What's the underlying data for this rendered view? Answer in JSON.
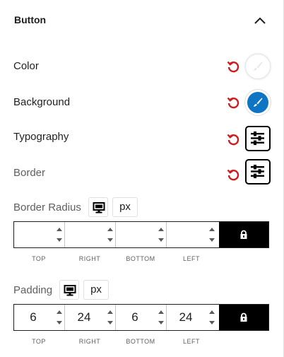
{
  "panel": {
    "title": "Button",
    "collapse_icon": "chevron-up-icon"
  },
  "colors": {
    "reset_red": "#d01c1f",
    "swatch_white": "#ffffff",
    "swatch_blue": "#0e74c4",
    "lock_bg": "#000000"
  },
  "settings": {
    "color_label": "Color",
    "background_label": "Background",
    "typography_label": "Typography",
    "border_label": "Border"
  },
  "border_radius": {
    "label": "Border Radius",
    "device_icon": "desktop-icon",
    "unit": "px",
    "values": {
      "top": "",
      "right": "",
      "bottom": "",
      "left": ""
    },
    "captions": {
      "top": "TOP",
      "right": "RIGHT",
      "bottom": "BOTTOM",
      "left": "LEFT"
    },
    "link_icon": "lock-icon"
  },
  "padding": {
    "label": "Padding",
    "device_icon": "desktop-icon",
    "unit": "px",
    "values": {
      "top": "6",
      "right": "24",
      "bottom": "6",
      "left": "24"
    },
    "captions": {
      "top": "TOP",
      "right": "RIGHT",
      "bottom": "BOTTOM",
      "left": "LEFT"
    },
    "link_icon": "lock-icon"
  }
}
